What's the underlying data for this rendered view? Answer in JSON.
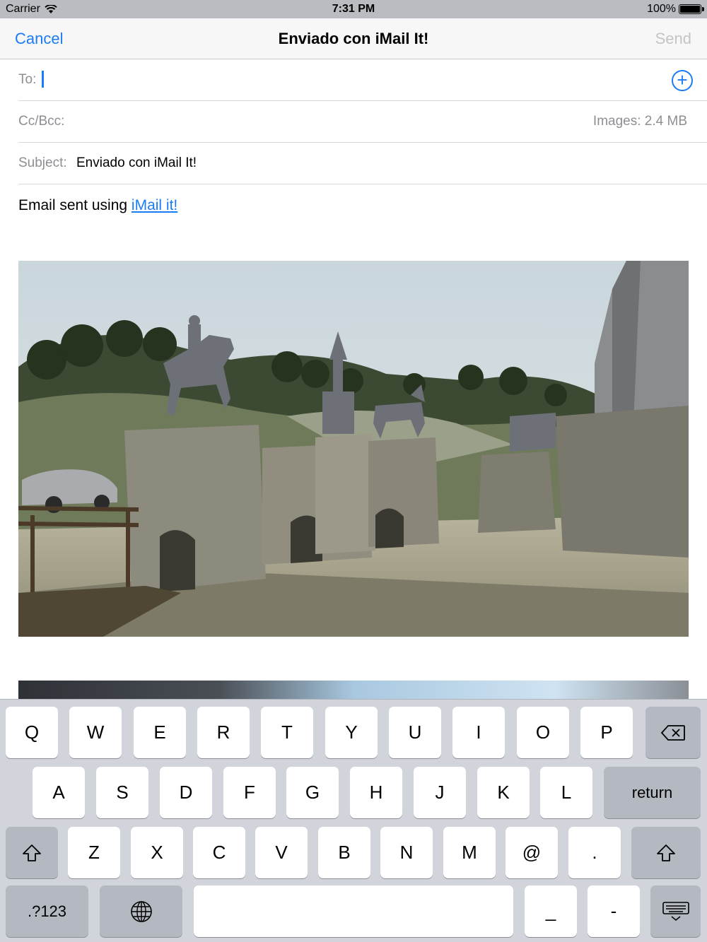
{
  "status_bar": {
    "carrier": "Carrier",
    "time": "7:31 PM",
    "battery": "100%",
    "battery_level": 1.0
  },
  "nav": {
    "cancel": "Cancel",
    "title": "Enviado con iMail It!",
    "send": "Send"
  },
  "fields": {
    "to_label": "To:",
    "to_value": "",
    "cc_label": "Cc/Bcc:",
    "images_label": "Images:",
    "images_size": "2.4 MB",
    "subject_label": "Subject:",
    "subject_value": "Enviado con iMail It!"
  },
  "body": {
    "text": "Email sent using ",
    "link": "iMail it!"
  },
  "attachments": [
    "photo-statues",
    "photo-partial"
  ],
  "keyboard": {
    "row1": [
      "Q",
      "W",
      "E",
      "R",
      "T",
      "Y",
      "U",
      "I",
      "O",
      "P"
    ],
    "row2": [
      "A",
      "S",
      "D",
      "F",
      "G",
      "H",
      "J",
      "K",
      "L"
    ],
    "row3": [
      "Z",
      "X",
      "C",
      "V",
      "B",
      "N",
      "M",
      "@",
      "."
    ],
    "return": "return",
    "numbers": ".?123",
    "underscore": "_",
    "dash": "-"
  },
  "colors": {
    "accent": "#1a7cf5",
    "disabled": "#c4c4c7",
    "label": "#8e8e93"
  }
}
